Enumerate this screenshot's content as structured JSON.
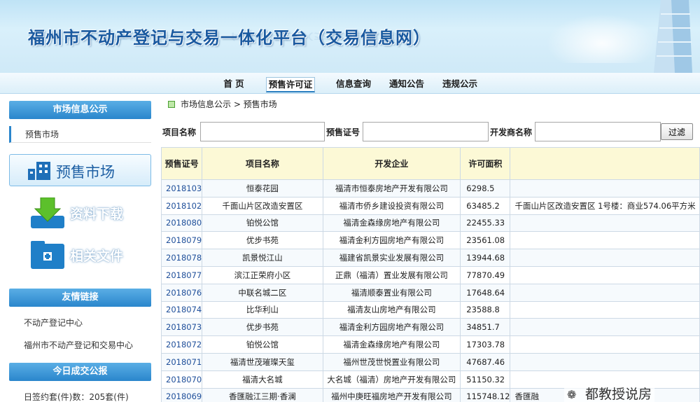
{
  "banner": {
    "title": "福州市不动产登记与交易一体化平台（交易信息网）"
  },
  "nav": [
    "首 页",
    "预售许可证",
    "信息查询",
    "通知公告",
    "违规公示"
  ],
  "sidebar": {
    "market_info_title": "市场信息公示",
    "market_info_item": "预售市场",
    "big_button": "预售市场",
    "download": "资料下载",
    "docs": "相关文件",
    "links_title": "友情链接",
    "links": [
      "不动产登记中心",
      "福州市不动产登记和交易中心"
    ],
    "today_title": "今日成交公报",
    "today_text": "日签约套(件)数：205套(件)"
  },
  "breadcrumb": "市场信息公示 > 预售市场",
  "filters": {
    "project_label": "项目名称",
    "permit_label": "预售证号",
    "developer_label": "开发商名称",
    "button": "过滤"
  },
  "table": {
    "headers": [
      "预售证号",
      "项目名称",
      "开发企业",
      "许可面积",
      ""
    ],
    "rows": [
      [
        "2018103",
        "恒泰花园",
        "福清市恒泰房地产开发有限公司",
        "6298.5",
        ""
      ],
      [
        "2018102",
        "千面山片区改造安置区",
        "福清市侨乡建设投资有限公司",
        "63485.2",
        "千面山片区改造安置区 1号楼：商业574.06平方米"
      ],
      [
        "2018080",
        "铂悦公馆",
        "福清金森缘房地产有限公司",
        "22455.33",
        ""
      ],
      [
        "2018079",
        "优步书苑",
        "福清金利方园房地产有限公司",
        "23561.08",
        ""
      ],
      [
        "2018078",
        "凯景悦江山",
        "福建省凯景实业发展有限公司",
        "13944.68",
        ""
      ],
      [
        "2018077",
        "滨江正荣府小区",
        "正鼎（福清）置业发展有限公司",
        "77870.49",
        ""
      ],
      [
        "2018076",
        "中联名城二区",
        "福清顺泰置业有限公司",
        "17648.64",
        ""
      ],
      [
        "2018074",
        "比华利山",
        "福清友山房地产有限公司",
        "23588.8",
        ""
      ],
      [
        "2018073",
        "优步书苑",
        "福清金利方园房地产有限公司",
        "34851.7",
        ""
      ],
      [
        "2018072",
        "铂悦公馆",
        "福清金森缘房地产有限公司",
        "17303.78",
        ""
      ],
      [
        "2018071",
        "福清世茂璀璨天玺",
        "福州世茂世悦置业有限公司",
        "47687.46",
        ""
      ],
      [
        "2018070",
        "福清大名城",
        "大名城（福清）房地产开发有限公司",
        "51150.32",
        ""
      ],
      [
        "2018069",
        "香匯融江三期·香澜",
        "福州中庚旺福房地产开发有限公司",
        "115748.12",
        "香匯融"
      ]
    ]
  },
  "watermark": "都教授说房"
}
